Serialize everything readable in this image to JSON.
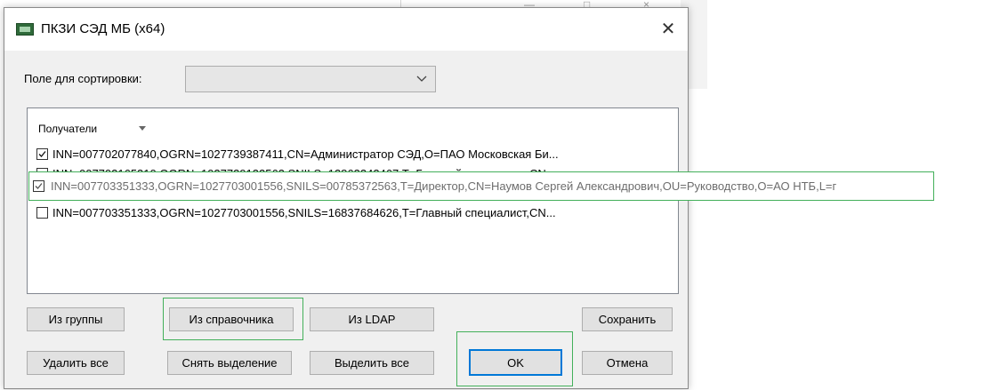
{
  "background_window": {
    "minimize_glyph": "—",
    "maximize_glyph": "□",
    "close_glyph": "×"
  },
  "dialog": {
    "title": "ПКЗИ СЭД МБ (x64)",
    "app_icon": "app-logo-icon",
    "close_glyph": "✕"
  },
  "sort": {
    "label": "Поле для сортировки:",
    "selected_value": "",
    "icon": "chevron-down-icon"
  },
  "recipients": {
    "header": "Получатели",
    "header_icon": "sort-down-arrow-icon",
    "items": [
      {
        "checked": true,
        "text": "INN=007702077840,OGRN=1027739387411,CN=Администратор СЭД,О=ПАО Московская Би..."
      },
      {
        "checked": false,
        "text": "INN=007702165310,OGRN=1027739132563,SNILS=13863242467,T=Главный специалист,CN..."
      },
      {
        "checked": true,
        "text": "INN=007703351333,OGRN=1027703001556,SNILS=00785372563,T=Директор,CN=Наумов Сергей Александрович,OU=Руководство,O=АО НТБ,L=г"
      },
      {
        "checked": false,
        "text": "INN=007703351333,OGRN=1027703001556,SNILS=16837684626,T=Главный специалист,CN..."
      }
    ]
  },
  "buttons": {
    "from_group": "Из группы",
    "from_directory": "Из справочника",
    "from_ldap": "Из LDAP",
    "save": "Сохранить",
    "delete_all": "Удалить все",
    "deselect": "Снять выделение",
    "select_all": "Выделить все",
    "ok": "OK",
    "cancel": "Отмена"
  },
  "colors": {
    "focus_frame": "#43b05a",
    "default_button_border": "#0078d7",
    "dialog_bg": "#f0f0f0"
  }
}
